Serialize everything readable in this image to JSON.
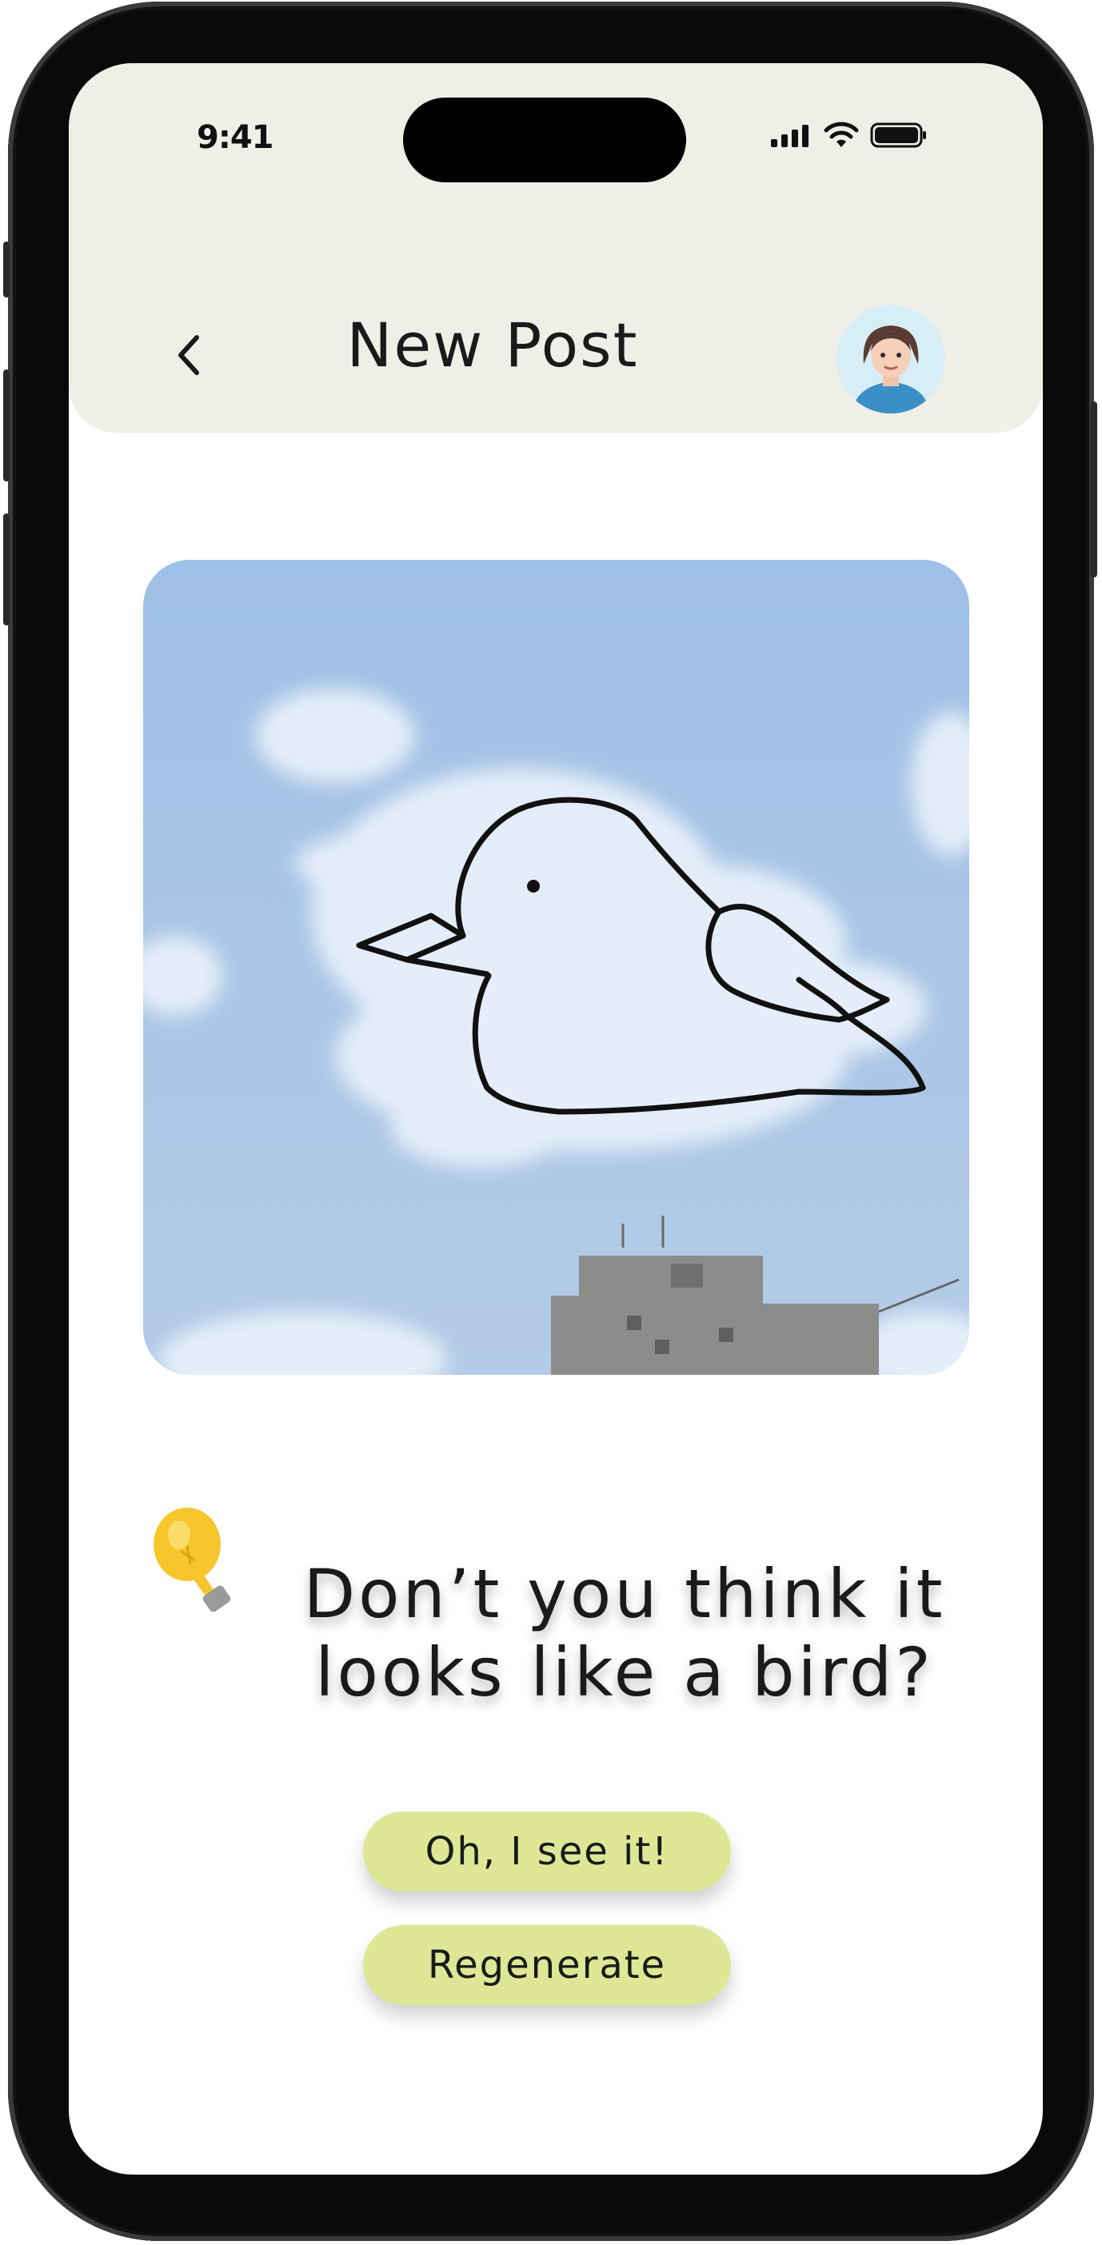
{
  "status_bar": {
    "time": "9:41",
    "signal_icon": "cellular-signal-icon",
    "wifi_icon": "wifi-icon",
    "battery_icon": "battery-icon"
  },
  "header": {
    "title": "New Post",
    "back_icon": "chevron-left-icon",
    "avatar_icon": "user-avatar"
  },
  "post": {
    "image_description_icon": "cloud-bird-photo"
  },
  "suggestion": {
    "icon": "lightbulb-icon",
    "text": "Don’t you think it\nlooks like a bird?"
  },
  "actions": {
    "confirm_label": "Oh, I see it!",
    "regenerate_label": "Regenerate"
  },
  "colors": {
    "header_bg": "#efefe8",
    "button_bg": "#dde796",
    "sky": "#a9c8e8"
  }
}
